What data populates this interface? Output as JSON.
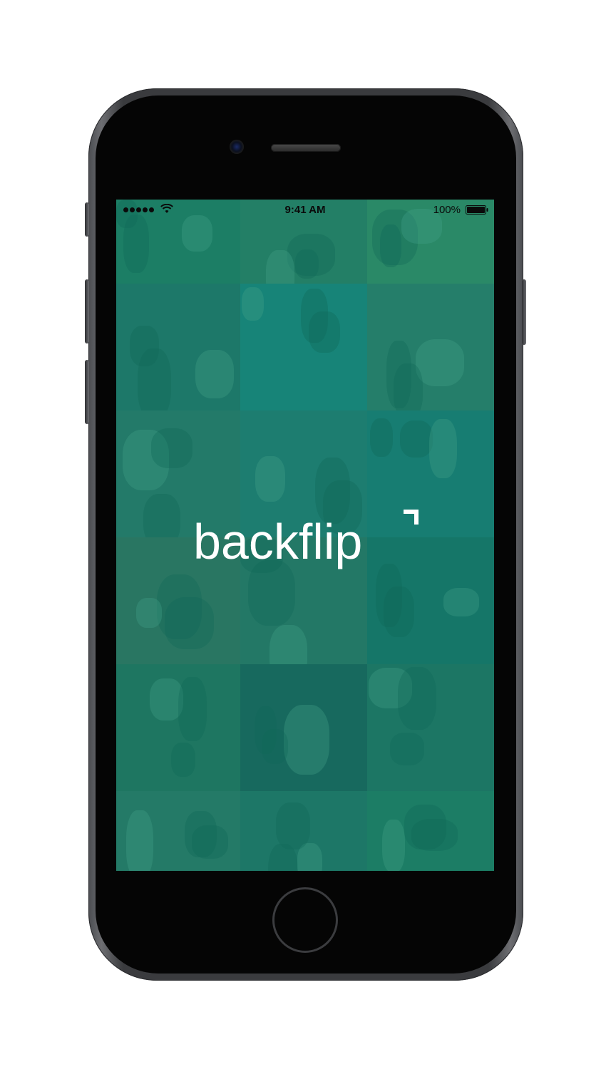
{
  "status_bar": {
    "time": "9:41 AM",
    "battery": "100%"
  },
  "app": {
    "logo_text": "backflip"
  },
  "theme": {
    "accent": "#11806b",
    "logo_color": "#ffffff",
    "tile_colors": [
      "#2a7d5e",
      "#3b7f5f",
      "#4a9463",
      "#2e6f66",
      "#1f8a88",
      "#3f7d68",
      "#3a7466",
      "#2d7a77",
      "#1f7a7a",
      "#476b58",
      "#3a6f60",
      "#1b6b64",
      "#2f6b54",
      "#214f4f",
      "#2a6a5c",
      "#3d7462",
      "#2d6d63",
      "#2a7a5d"
    ]
  }
}
